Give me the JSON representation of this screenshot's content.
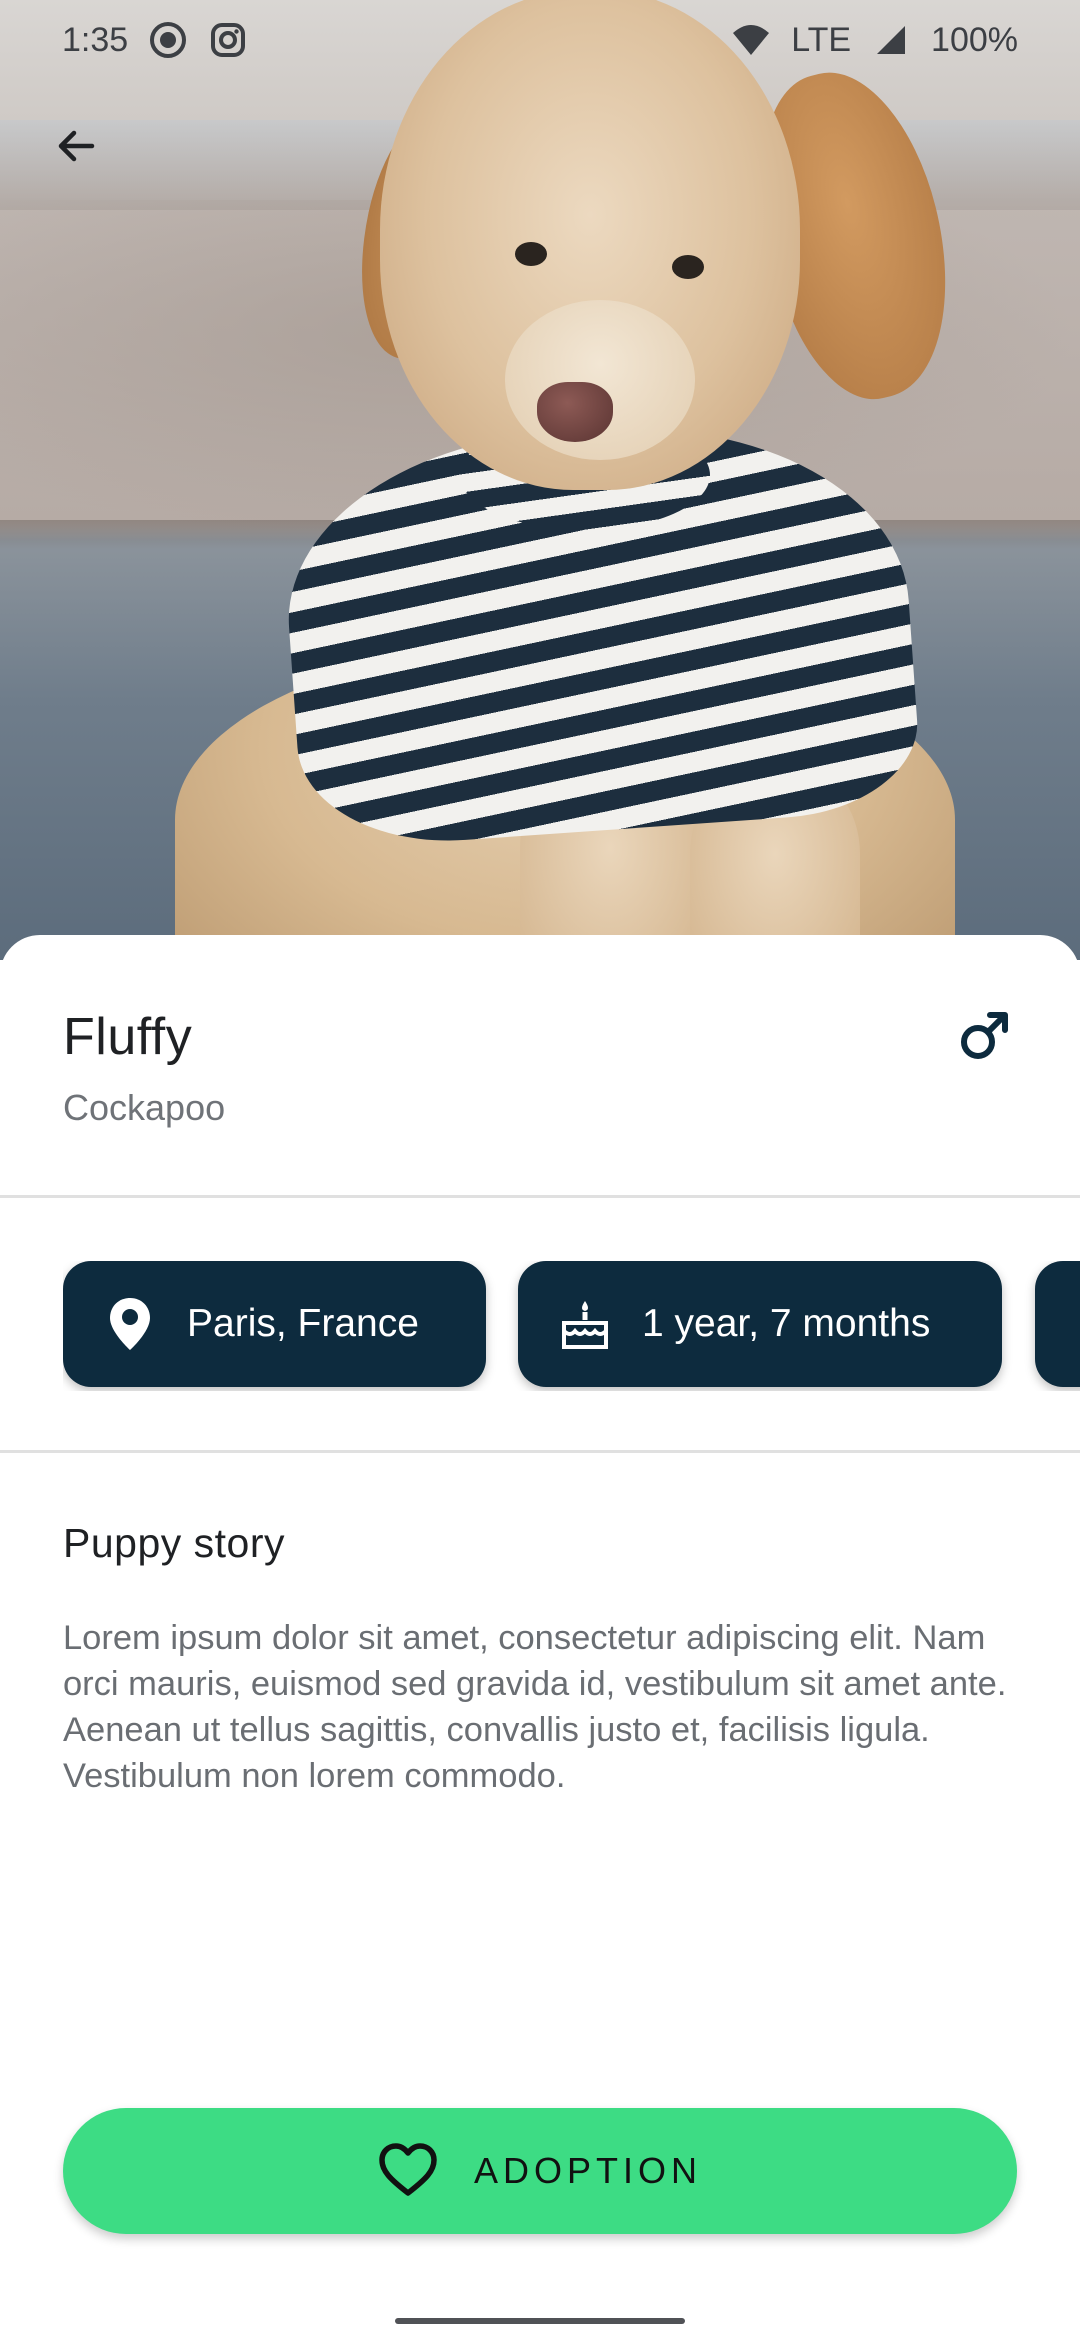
{
  "status_bar": {
    "time": "1:35",
    "network": "LTE",
    "battery": "100%"
  },
  "navigation": {
    "back_icon": "arrow-back-icon"
  },
  "pet": {
    "name": "Fluffy",
    "breed": "Cockapoo",
    "gender_icon": "male-icon",
    "photo": "puppy-photo"
  },
  "chips": [
    {
      "icon": "location-pin-icon",
      "label": "Paris, France"
    },
    {
      "icon": "cake-icon",
      "label": "1 year, 7 months"
    },
    {
      "icon": "unknown-icon",
      "label": ""
    }
  ],
  "story": {
    "title": "Puppy story",
    "text": "Lorem ipsum dolor sit amet, consectetur adipiscing elit. Nam orci mauris, euismod sed gravida id, vestibulum sit amet ante. Aenean ut tellus sagittis, convallis justo et, facilisis ligula. Vestibulum non lorem commodo."
  },
  "action": {
    "icon": "heart-icon",
    "label": "ADOPTION"
  },
  "colors": {
    "chip_background": "#0d2b3e",
    "adopt_button": "#3ddc84",
    "gender_icon": "#0d2b3e"
  }
}
